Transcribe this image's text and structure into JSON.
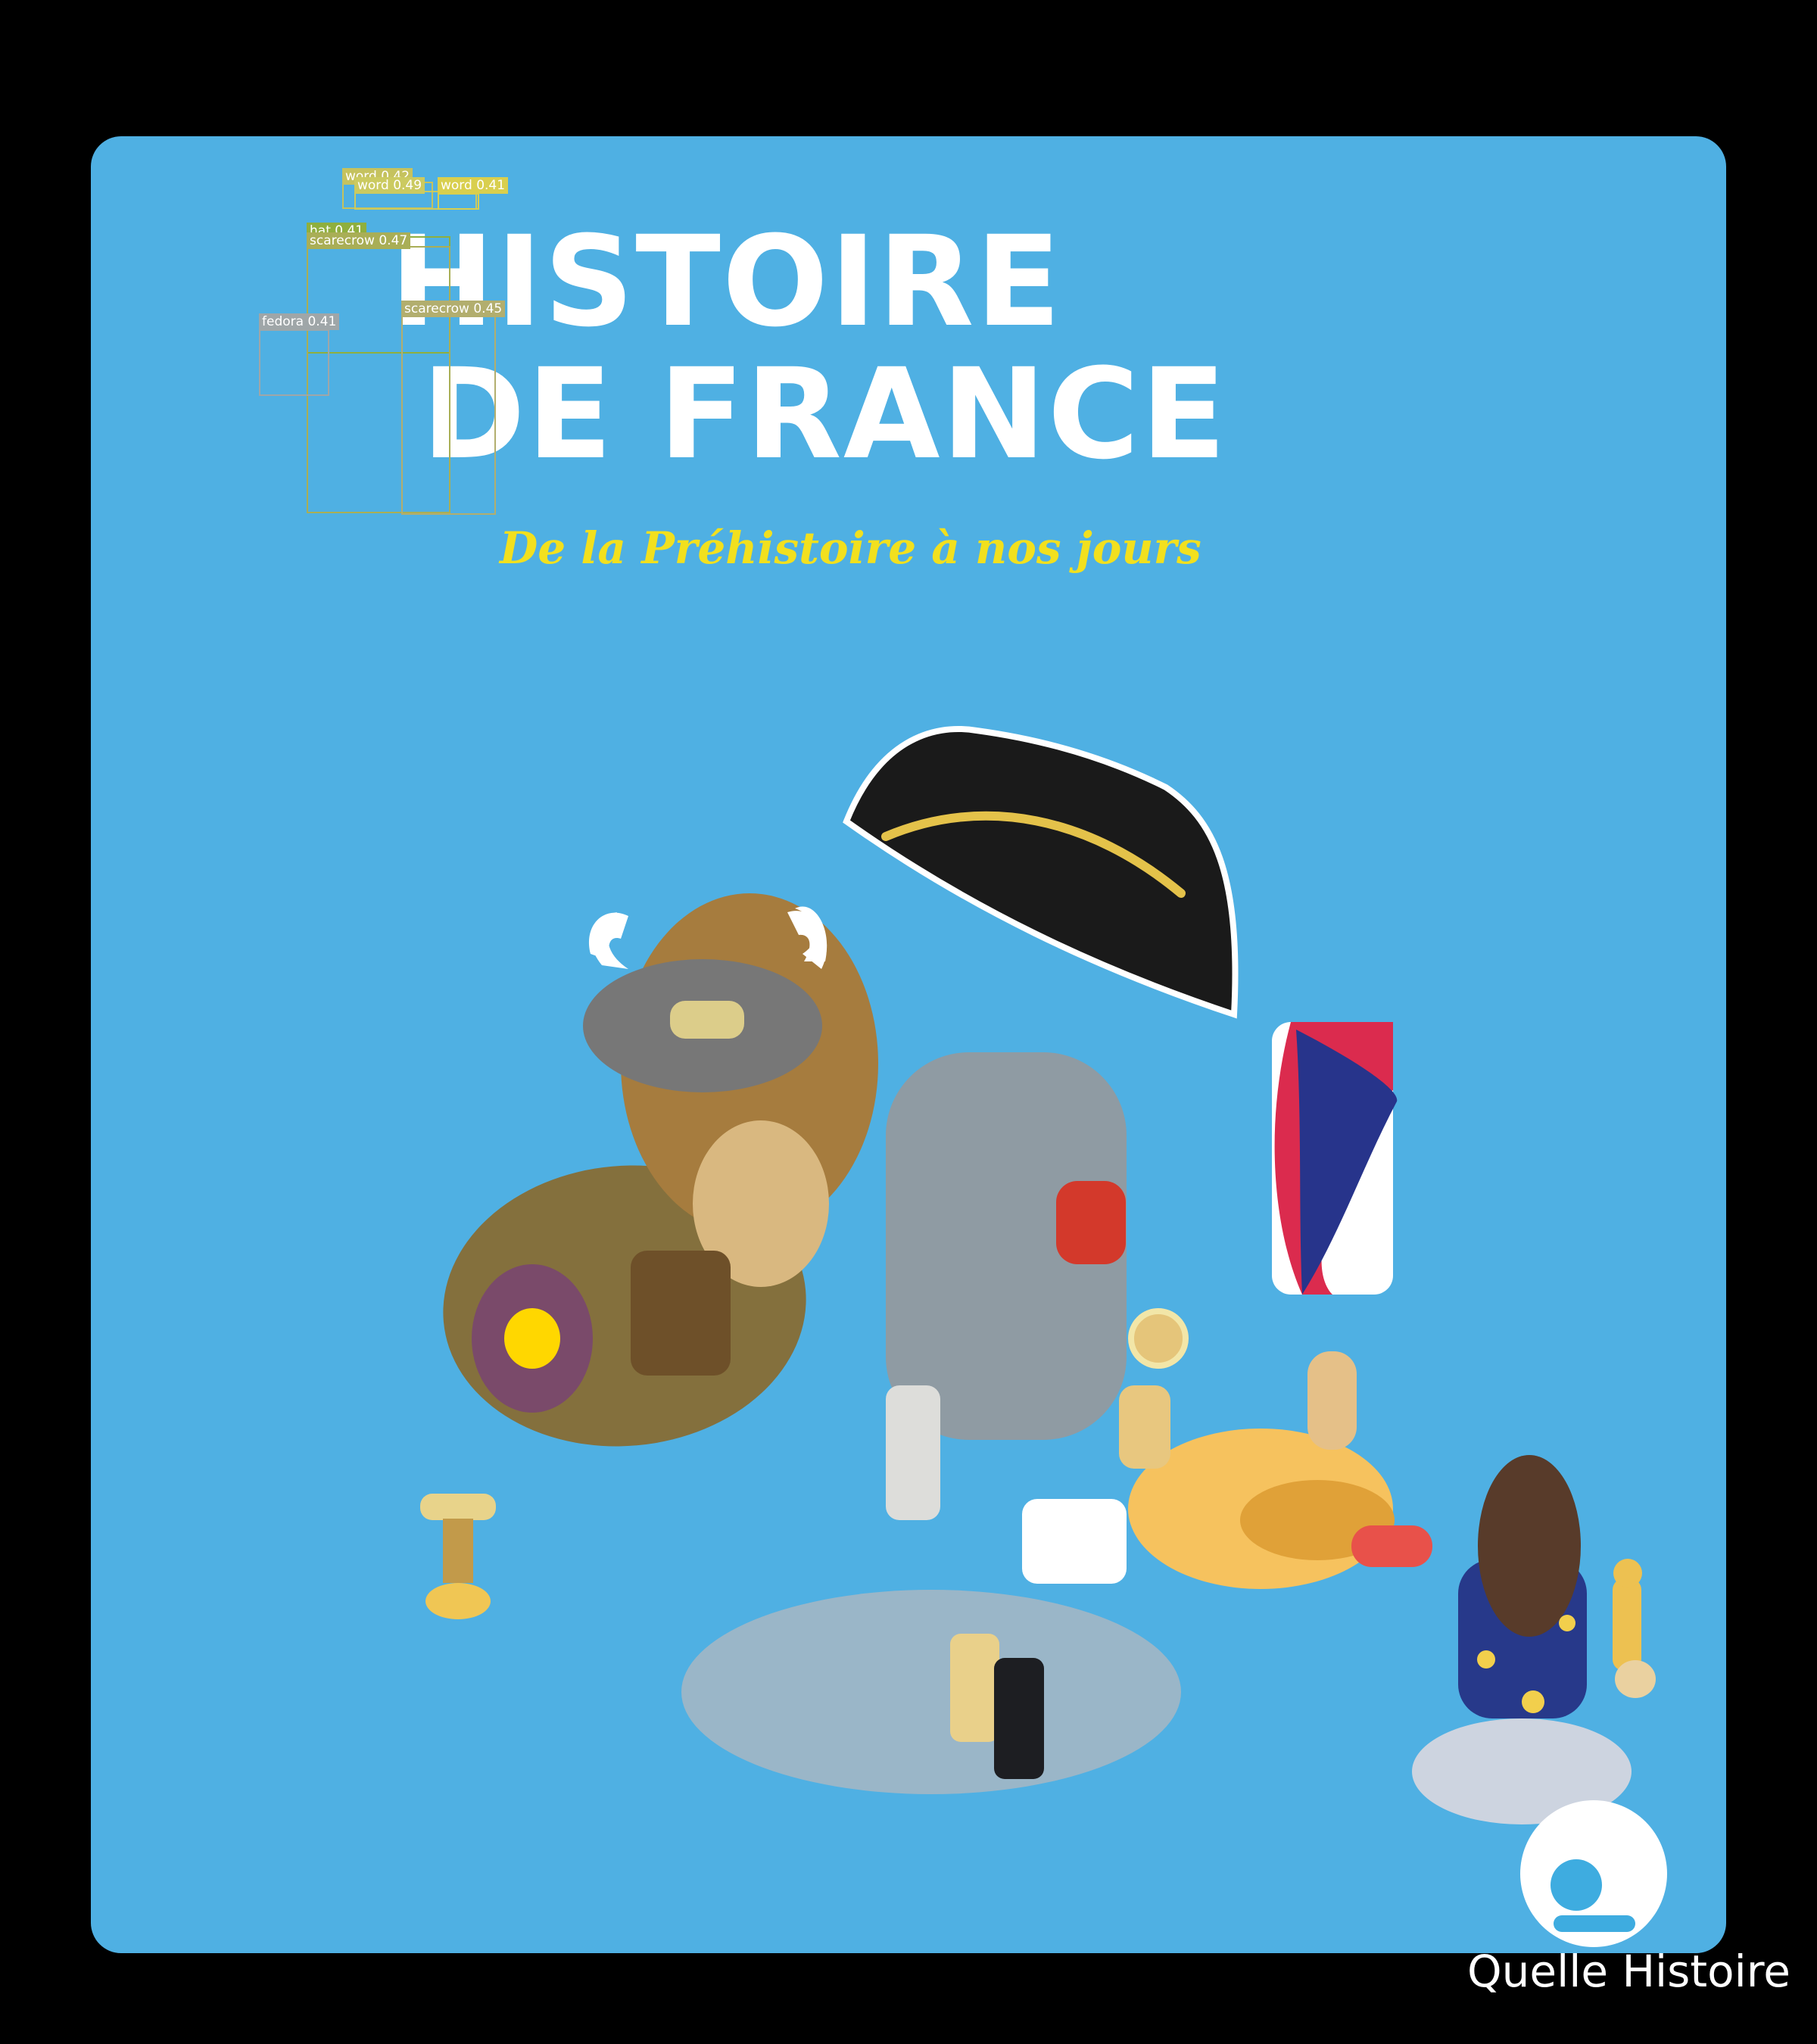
{
  "cover": {
    "title_line1": "HISTOIRE",
    "title_line2": "DE FRANCE",
    "subtitle": "De la Préhistoire à nos jours",
    "publisher": "Quelle Histoire"
  },
  "colors": {
    "background": "#000000",
    "card": "#4FB0E3",
    "title": "#FFFFFF",
    "subtitle": "#F2E01E"
  },
  "illustration": {
    "elements": [
      "bicorne-hat",
      "viking-helmet",
      "bison",
      "knight-armor",
      "french-flag-banner",
      "shield",
      "sun-king-figure",
      "child-figure",
      "round-table"
    ]
  },
  "detections": [
    {
      "label": "word 0.42"
    },
    {
      "label": "word 0.49"
    },
    {
      "label": "word 0.41"
    },
    {
      "label": "hat 0.41"
    },
    {
      "label": "scarecrow 0.47"
    },
    {
      "label": "scarecrow 0.45"
    },
    {
      "label": "fedora 0.41"
    }
  ],
  "logo": {
    "icon": "person-icon"
  }
}
